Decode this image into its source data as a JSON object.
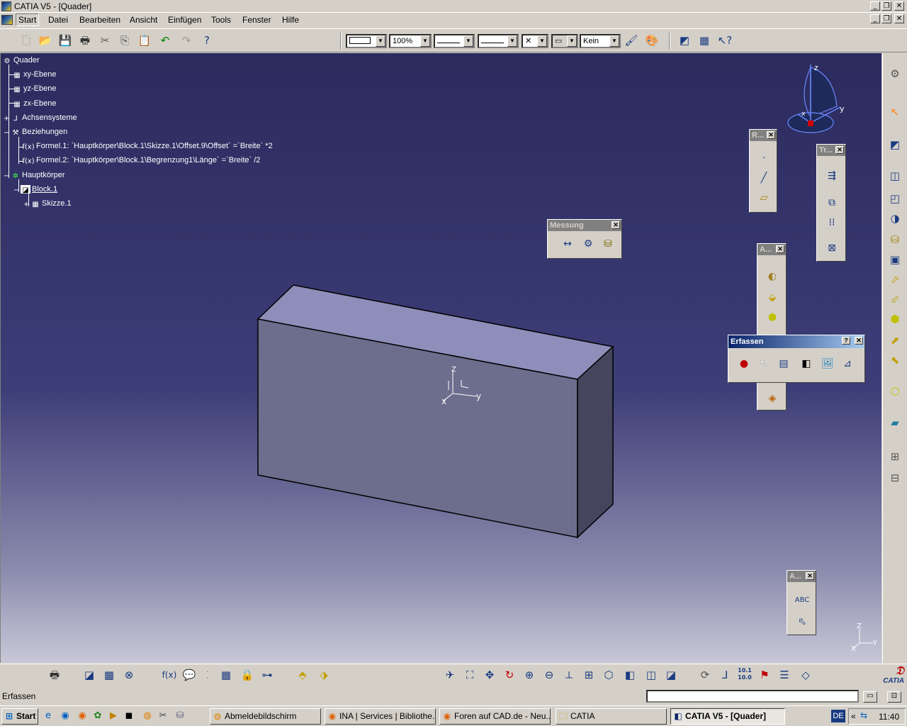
{
  "window": {
    "title": "CATIA V5 - [Quader]"
  },
  "menu": {
    "items": [
      "Start",
      "Datei",
      "Bearbeiten",
      "Ansicht",
      "Einfügen",
      "Tools",
      "Fenster",
      "Hilfe"
    ]
  },
  "toolbar": {
    "zoom_value": "100%",
    "line_type": "Kein"
  },
  "tree": {
    "root": "Quader",
    "xy": "xy-Ebene",
    "yz": "yz-Ebene",
    "zx": "zx-Ebene",
    "axes": "Achsensysteme",
    "relations": "Beziehungen",
    "formula1": "Formel.1: `Hauptkörper\\Block.1\\Skizze.1\\Offset.9\\Offset` =`Breite` *2",
    "formula2": "Formel.2: `Hauptkörper\\Block.1\\Begrenzung1\\Länge` =`Breite` /2",
    "body": "Hauptkörper",
    "block": "Block.1",
    "sketch": "Skizze.1"
  },
  "panels": {
    "messung": "Messung",
    "r": "R...",
    "tr": "Tr...",
    "a1": "A...",
    "a2": "A...",
    "erfassen": "Erfassen",
    "help": "?"
  },
  "compass": {
    "z": "z",
    "y": "y",
    "x": "x"
  },
  "part_axes": {
    "z": "Z",
    "y": "y",
    "x": "x"
  },
  "corner_axes": {
    "z": "Z",
    "y": "Y",
    "x": "X"
  },
  "status": {
    "text": "Erfassen"
  },
  "bottom": {
    "num_icon": "10.1 10.0",
    "logo": "CATIA"
  },
  "taskbar": {
    "start": "Start",
    "tasks": [
      "Abmeldebildschirm",
      "INA | Services | Bibliothe...",
      "Foren auf CAD.de - Neu...",
      "CATIA",
      "CATIA V5 - [Quader]"
    ],
    "lang": "DE",
    "chevron": "«",
    "time": "11:40"
  }
}
